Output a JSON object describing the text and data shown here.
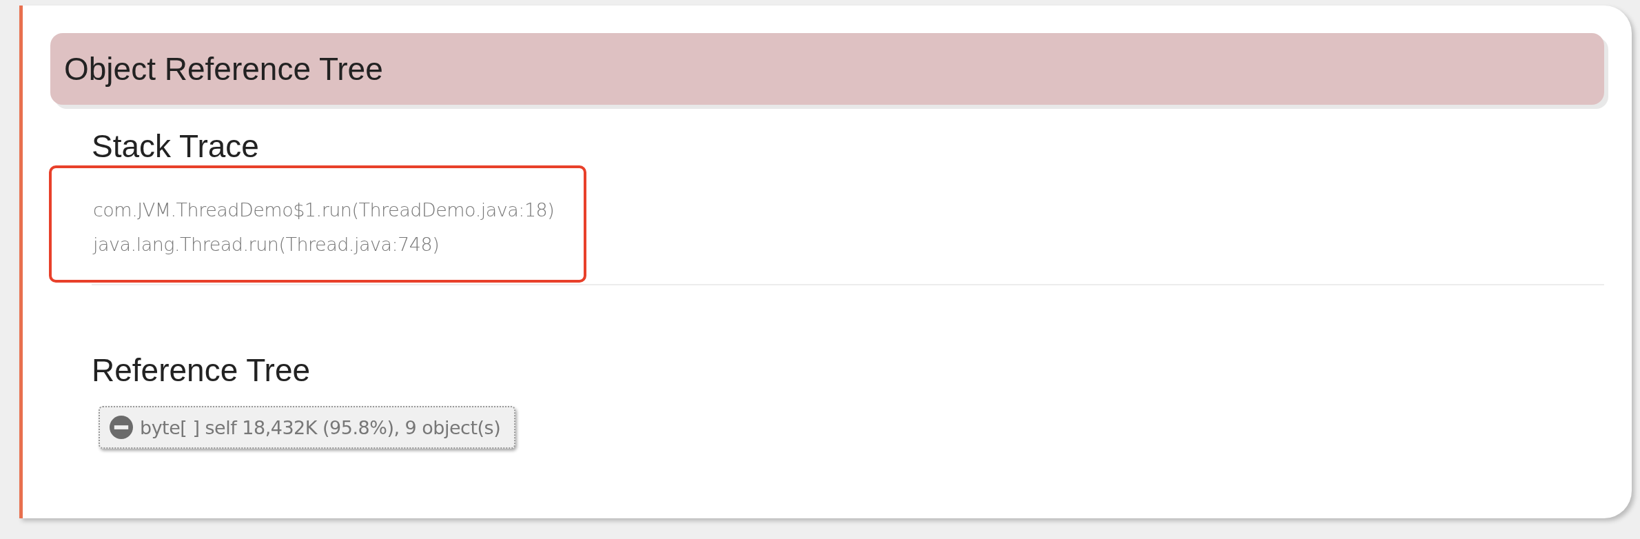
{
  "header": {
    "title": "Object Reference Tree"
  },
  "stack_trace": {
    "title": "Stack Trace",
    "highlighted": true,
    "frames": [
      "com.JVM.ThreadDemo$1.run(ThreadDemo.java:18)",
      "java.lang.Thread.run(Thread.java:748)"
    ]
  },
  "reference_tree": {
    "title": "Reference Tree",
    "nodes": [
      {
        "label": "byte[ ] self 18,432K (95.8%), 9 object(s)",
        "expanded": true
      }
    ]
  }
}
